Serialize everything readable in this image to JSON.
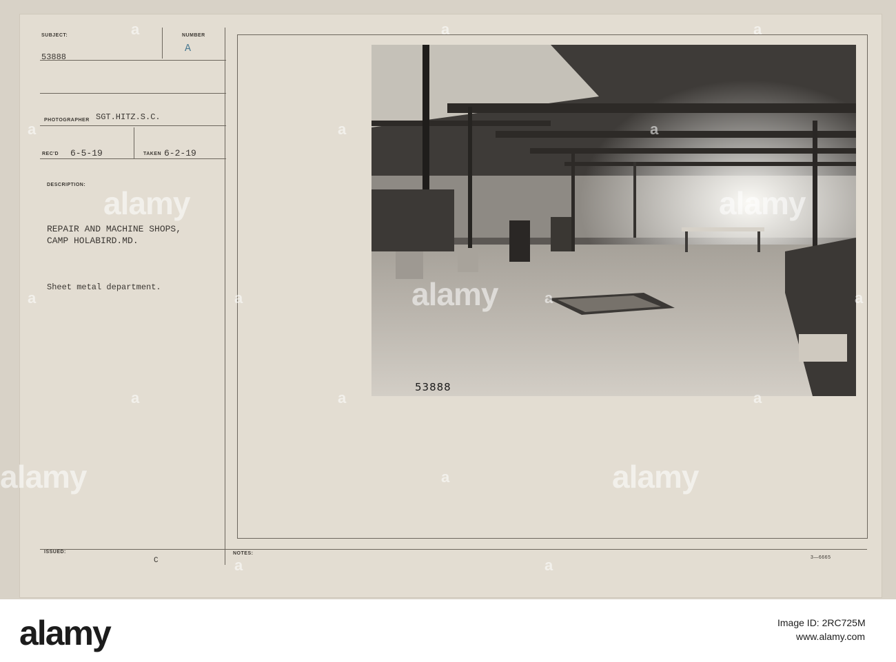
{
  "card": {
    "subject_label": "SUBJECT:",
    "subject_value": "53888",
    "number_label": "NUMBER",
    "number_value": "A",
    "photographer_label": "PHOTOGRAPHER",
    "photographer_value": "SGT.HITZ.S.C.",
    "recd_label": "REC'D",
    "recd_value": "6-5-19",
    "taken_label": "TAKEN",
    "taken_value": "6-2-19",
    "description_label": "DESCRIPTION:",
    "description_line1": "REPAIR AND MACHINE SHOPS,",
    "description_line2": "CAMP HOLABIRD.MD.",
    "description_line3": "Sheet metal department.",
    "issued_label": "ISSUED:",
    "issued_value": "C",
    "notes_label": "NOTES:",
    "form_code": "3—6665",
    "negative_number": "53888"
  },
  "watermark": {
    "logo_text": "alamy",
    "small_mark": "a"
  },
  "banner": {
    "logo_text": "alamy",
    "image_id_line": "Image ID: 2RC725M",
    "site_line": "www.alamy.com"
  },
  "colors": {
    "card_paper": "#e3ddd2",
    "ink": "#3a3632",
    "photo_mid_gray": "#8a8580",
    "banner_background": "#ffffff"
  }
}
